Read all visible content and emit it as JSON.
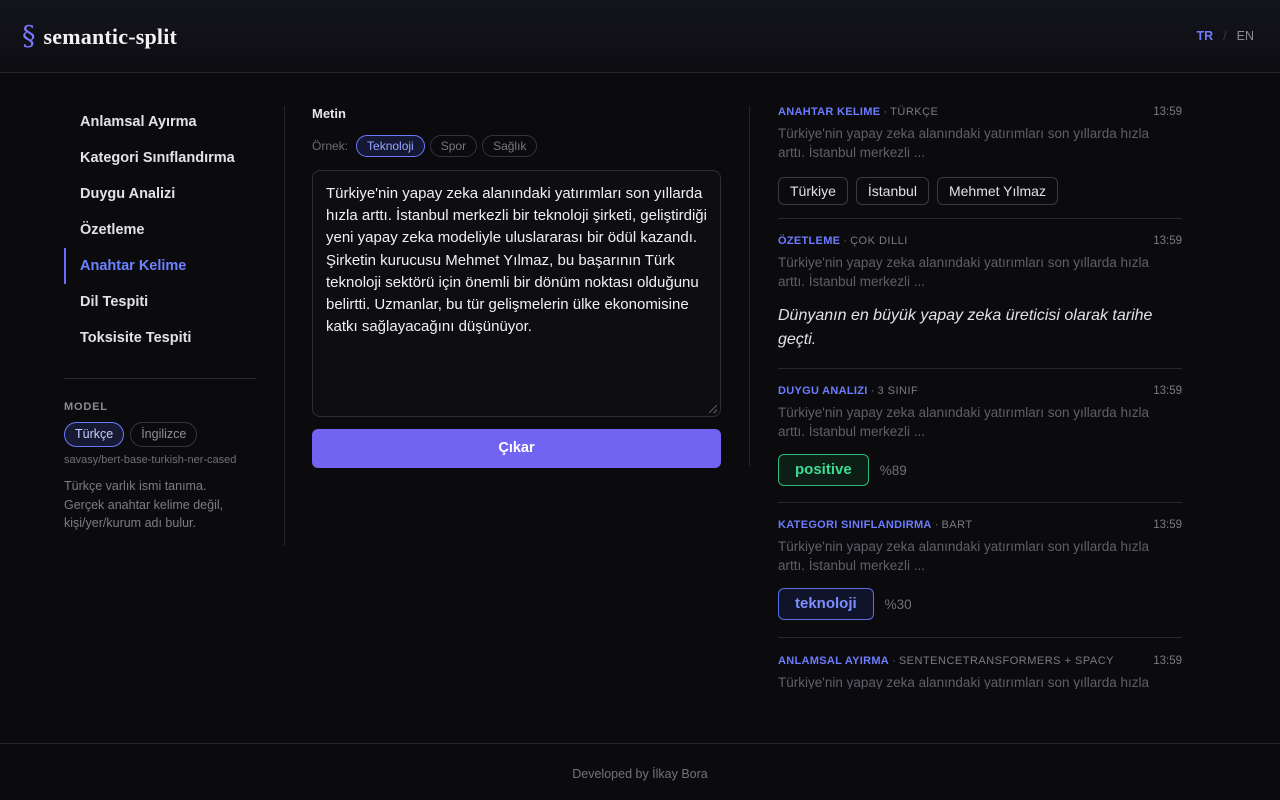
{
  "header": {
    "logo_mark": "§",
    "app_name": "semantic-split",
    "lang_active": "TR",
    "lang_sep": "/",
    "lang_other": "EN"
  },
  "sidebar": {
    "items": [
      {
        "label": "Anlamsal Ayırma",
        "active": false
      },
      {
        "label": "Kategori Sınıflandırma",
        "active": false
      },
      {
        "label": "Duygu Analizi",
        "active": false
      },
      {
        "label": "Özetleme",
        "active": false
      },
      {
        "label": "Anahtar Kelime",
        "active": true
      },
      {
        "label": "Dil Tespiti",
        "active": false
      },
      {
        "label": "Toksisite Tespiti",
        "active": false
      }
    ],
    "model_label": "MODEL",
    "model_options": [
      {
        "label": "Türkçe",
        "active": true
      },
      {
        "label": "İngilizce",
        "active": false
      }
    ],
    "model_path": "savasy/bert-base-turkish-ner-cased",
    "model_desc": "Türkçe varlık ismi tanıma. Gerçek anahtar kelime değil, kişi/yer/kurum adı bulur."
  },
  "editor": {
    "label": "Metin",
    "examples_label": "Örnek:",
    "examples": [
      {
        "label": "Teknoloji",
        "active": true
      },
      {
        "label": "Spor",
        "active": false
      },
      {
        "label": "Sağlık",
        "active": false
      }
    ],
    "text": "Türkiye'nin yapay zeka alanındaki yatırımları son yıllarda hızla arttı. İstanbul merkezli bir teknoloji şirketi, geliştirdiği yeni yapay zeka modeliyle uluslararası bir ödül kazandı. Şirketin kurucusu Mehmet Yılmaz, bu başarının Türk teknoloji sektörü için önemli bir dönüm noktası olduğunu belirtti. Uzmanlar, bu tür gelişmelerin ülke ekonomisine katkı sağlayacağını düşünüyor.",
    "submit_label": "Çıkar"
  },
  "results": {
    "c1": {
      "type": "ANAHTAR KELIME",
      "sub": "TÜRKÇE",
      "time": "13:59",
      "snippet": "Türkiye'nin yapay zeka alanındaki yatırımları son yıllarda hızla arttı. İstanbul merkezli ...",
      "keywords": [
        "Türkiye",
        "İstanbul",
        "Mehmet Yılmaz"
      ]
    },
    "c2": {
      "type": "ÖZETLEME",
      "sub": "ÇOK DILLI",
      "time": "13:59",
      "snippet": "Türkiye'nin yapay zeka alanındaki yatırımları son yıllarda hızla arttı. İstanbul merkezli ...",
      "summary": "Dünyanın en büyük yapay zeka üreticisi olarak tarihe geçti."
    },
    "c3": {
      "type": "DUYGU ANALIZI",
      "sub": "3 SINIF",
      "time": "13:59",
      "snippet": "Türkiye'nin yapay zeka alanındaki yatırımları son yıllarda hızla arttı. İstanbul merkezli ...",
      "label": "positive",
      "score": "%89"
    },
    "c4": {
      "type": "KATEGORI SINIFLANDIRMA",
      "sub": "BART",
      "time": "13:59",
      "snippet": "Türkiye'nin yapay zeka alanındaki yatırımları son yıllarda hızla arttı. İstanbul merkezli ...",
      "label": "teknoloji",
      "score": "%30"
    },
    "c5": {
      "type": "ANLAMSAL AYIRMA",
      "sub": "SENTENCETRANSFORMERS + SPACY",
      "time": "13:59",
      "snippet": "Türkiye'nin yapay zeka alanındaki yatırımları son yıllarda hızla arttı. İstanbul merkezli ..."
    }
  },
  "footer": {
    "text": "Developed by İlkay Bora"
  },
  "colors": {
    "accent": "#7264f2",
    "accent_text": "#6d7cff",
    "positive": "#3ddc92",
    "background": "#0b0b0e"
  }
}
